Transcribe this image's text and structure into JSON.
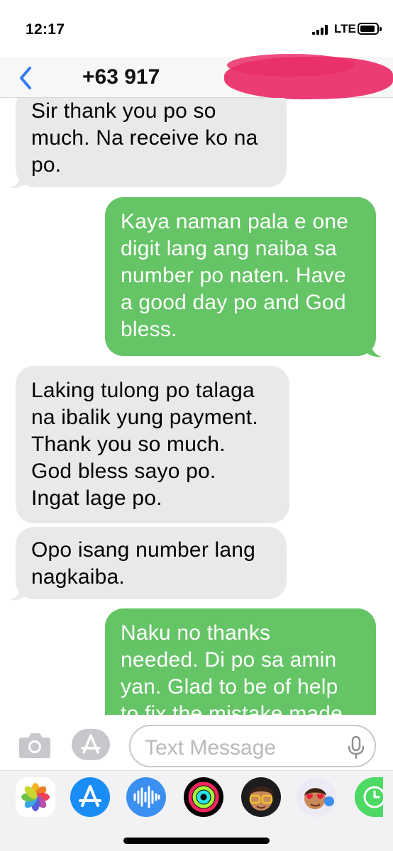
{
  "status_bar": {
    "time": "12:17",
    "network": "LTE",
    "icons": [
      "signal-bars-icon",
      "battery-icon"
    ]
  },
  "header": {
    "contact_number": "+63 917 ",
    "back_icon": "chevron-left-icon",
    "accent_color": "#3478f6",
    "redaction_color": "#ea2e68"
  },
  "messages": [
    {
      "direction": "incoming",
      "lines": [
        "Sir thank you po so",
        "much. Na receive ko na",
        "po."
      ]
    },
    {
      "direction": "outgoing",
      "lines": [
        "Kaya naman pala e one",
        "digit lang ang naiba sa",
        "number po naten. Have",
        "a good day po and God",
        "bless."
      ]
    },
    {
      "direction": "incoming",
      "lines": [
        "Laking tulong po talaga",
        "na ibalik yung payment.",
        "Thank you so much.",
        "God bless sayo po.",
        "Ingat lage po."
      ]
    },
    {
      "direction": "incoming",
      "lines": [
        "Opo isang number lang",
        "nagkaiba."
      ]
    },
    {
      "direction": "outgoing",
      "lines": [
        "Naku no thanks",
        "needed. Di po sa amin",
        "yan. Glad to be of help",
        "to fix the mistake made"
      ]
    }
  ],
  "colors": {
    "incoming_bubble": "#e9e9eb",
    "outgoing_bubble": "#65c466"
  },
  "input": {
    "placeholder": "Text Message",
    "icons": [
      "camera-icon",
      "app-store-icon",
      "microphone-icon"
    ]
  },
  "app_drawer": {
    "apps": [
      "photos-icon",
      "app-store-icon",
      "audio-message-icon",
      "activity-icon",
      "memoji-icon",
      "memoji-stickers-icon",
      "digital-touch-icon"
    ]
  }
}
